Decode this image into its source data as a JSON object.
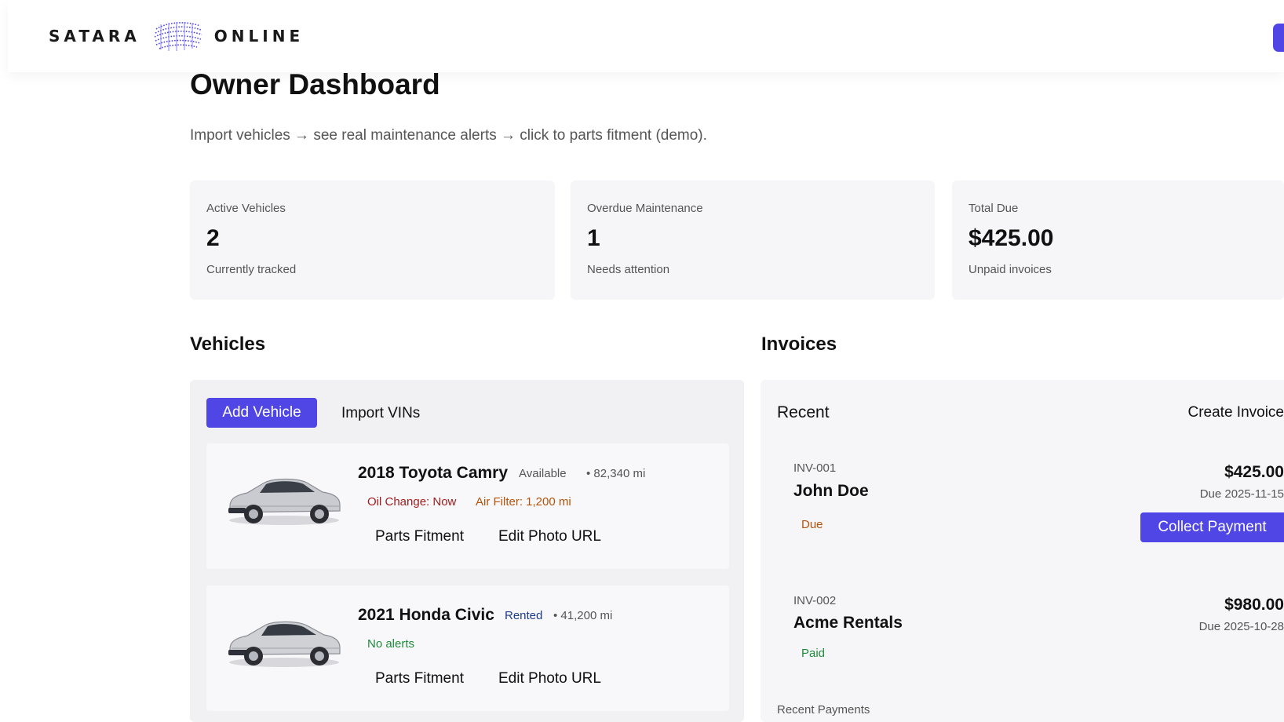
{
  "brand": {
    "left": "SATARA",
    "right": "ONLINE",
    "logo_icon": "wave-sphere-logo",
    "accent": "#4f46e5"
  },
  "page": {
    "title": "Owner Dashboard",
    "subtitle": "Import vehicles → see real maintenance alerts → click to parts fitment (demo)."
  },
  "stats": [
    {
      "label": "Active Vehicles",
      "value": "2",
      "note": "Currently tracked"
    },
    {
      "label": "Overdue Maintenance",
      "value": "1",
      "note": "Needs attention"
    },
    {
      "label": "Total Due",
      "value": "$425.00",
      "note": "Unpaid invoices"
    }
  ],
  "vehicles": {
    "title": "Vehicles",
    "add_label": "Add Vehicle",
    "import_label": "Import VINs",
    "items": [
      {
        "name": "2018 Toyota Camry",
        "status": "Available",
        "miles": "• 82,340 mi",
        "alerts": [
          "Oil Change: Now",
          "Air Filter: 1,200 mi"
        ],
        "fitment_label": "Parts Fitment",
        "photo_label": "Edit Photo URL"
      },
      {
        "name": "2021 Honda Civic",
        "status": "Rented",
        "miles": "• 41,200 mi",
        "alerts": [
          "No alerts"
        ],
        "fitment_label": "Parts Fitment",
        "photo_label": "Edit Photo URL"
      }
    ]
  },
  "invoices": {
    "title": "Invoices",
    "recent_label": "Recent",
    "create_label": "Create Invoice",
    "items": [
      {
        "id": "INV-001",
        "name": "John Doe",
        "status": "Due",
        "amount": "$425.00",
        "due": "Due 2025-11-15",
        "action": "Collect Payment"
      },
      {
        "id": "INV-002",
        "name": "Acme Rentals",
        "status": "Paid",
        "amount": "$980.00",
        "due": "Due 2025-10-28"
      }
    ],
    "recent_payments_label": "Recent Payments"
  },
  "colors": {
    "primary": "#4f46e5",
    "danger": "#a11d1d",
    "warning": "#b45309",
    "success": "#1f8a3b",
    "info": "#1e3a8a"
  }
}
